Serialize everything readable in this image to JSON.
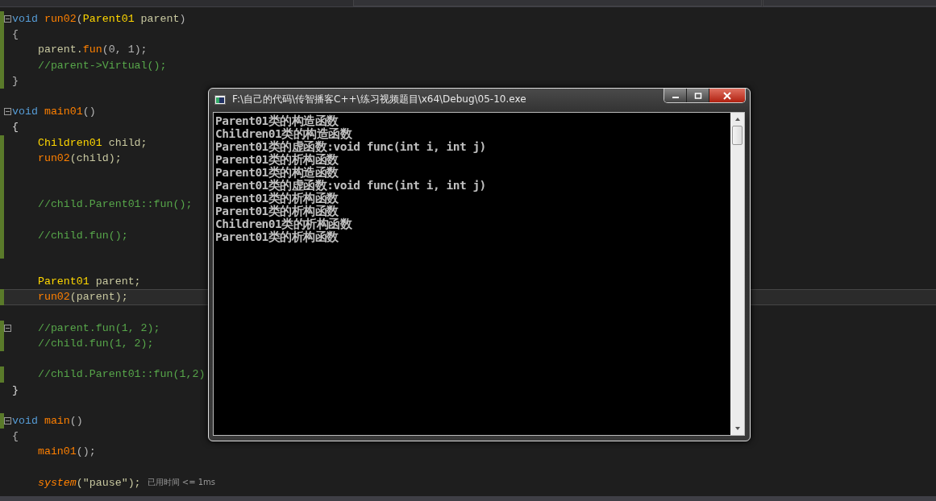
{
  "editor": {
    "lines": [
      {
        "tokens": [
          {
            "t": "void ",
            "color": "#569cd6"
          },
          {
            "t": "run02",
            "color": "#ff8000"
          },
          {
            "t": "(",
            "color": "#b4b4b4"
          },
          {
            "t": "Parent01",
            "color": "#ffd700"
          },
          {
            "t": " parent",
            "color": "#c8c8a0"
          },
          {
            "t": ")",
            "color": "#b4b4b4"
          }
        ],
        "fold": true,
        "changed": true,
        "current": false
      },
      {
        "tokens": [
          {
            "t": "{",
            "color": "#b4b4b4"
          }
        ],
        "fold": false,
        "changed": true,
        "current": false
      },
      {
        "tokens": [
          {
            "t": "    parent.",
            "color": "#c8c8a0"
          },
          {
            "t": "fun",
            "color": "#ff8000"
          },
          {
            "t": "(0, 1);",
            "color": "#b4b4b4"
          }
        ],
        "fold": false,
        "changed": true,
        "current": false
      },
      {
        "tokens": [
          {
            "t": "    //parent->Virtual();",
            "color": "#57a64a"
          }
        ],
        "fold": false,
        "changed": true,
        "current": false
      },
      {
        "tokens": [
          {
            "t": "}",
            "color": "#b4b4b4"
          }
        ],
        "fold": false,
        "changed": true,
        "current": false
      },
      {
        "fold": false,
        "changed": false,
        "current": false
      },
      {
        "tokens": [
          {
            "t": "void ",
            "color": "#569cd6"
          },
          {
            "t": "main01",
            "color": "#ff8000"
          },
          {
            "t": "()",
            "color": "#b4b4b4"
          }
        ],
        "fold": true,
        "changed": false,
        "current": false
      },
      {
        "tokens": [
          {
            "t": "{",
            "color": "#dcdcdc"
          }
        ],
        "fold": false,
        "changed": false,
        "current": false
      },
      {
        "tokens": [
          {
            "t": "    Children01",
            "color": "#ffd700"
          },
          {
            "t": " child;",
            "color": "#c8c8a0"
          }
        ],
        "fold": false,
        "changed": true,
        "current": false
      },
      {
        "tokens": [
          {
            "t": "    run02",
            "color": "#ff8000"
          },
          {
            "t": "(child);",
            "color": "#c8c8a0"
          }
        ],
        "fold": false,
        "changed": true,
        "current": false
      },
      {
        "fold": false,
        "changed": true,
        "current": false
      },
      {
        "fold": false,
        "changed": true,
        "current": false
      },
      {
        "tokens": [
          {
            "t": "    //child.Parent01::fun();",
            "color": "#57a64a"
          }
        ],
        "fold": false,
        "changed": true,
        "current": false
      },
      {
        "fold": false,
        "changed": true,
        "current": false
      },
      {
        "tokens": [
          {
            "t": "    //child.fun();",
            "color": "#57a64a"
          }
        ],
        "fold": false,
        "changed": true,
        "current": false
      },
      {
        "fold": false,
        "changed": true,
        "current": false
      },
      {
        "fold": false,
        "changed": false,
        "current": false
      },
      {
        "tokens": [
          {
            "t": "    Parent01",
            "color": "#ffd700"
          },
          {
            "t": " parent;",
            "color": "#c8c8a0"
          }
        ],
        "fold": false,
        "changed": false,
        "current": false
      },
      {
        "tokens": [
          {
            "t": "    run02",
            "color": "#ff8000"
          },
          {
            "t": "(parent);",
            "color": "#c8c8a0"
          }
        ],
        "fold": false,
        "changed": true,
        "current": true
      },
      {
        "fold": false,
        "changed": false,
        "current": false
      },
      {
        "tokens": [
          {
            "t": "    //parent.fun(1, 2);",
            "color": "#57a64a"
          }
        ],
        "fold": true,
        "changed": true,
        "current": false
      },
      {
        "tokens": [
          {
            "t": "    //child.fun(1, 2);",
            "color": "#57a64a"
          }
        ],
        "fold": false,
        "changed": true,
        "current": false
      },
      {
        "fold": false,
        "changed": false,
        "current": false
      },
      {
        "tokens": [
          {
            "t": "    //child.Parent01::fun(1,2)",
            "color": "#57a64a"
          }
        ],
        "fold": false,
        "changed": true,
        "current": false
      },
      {
        "tokens": [
          {
            "t": "}",
            "color": "#dcdcdc"
          }
        ],
        "fold": false,
        "changed": false,
        "current": false
      },
      {
        "fold": false,
        "changed": false,
        "current": false
      },
      {
        "tokens": [
          {
            "t": "void ",
            "color": "#569cd6"
          },
          {
            "t": "main",
            "color": "#ff8000"
          },
          {
            "t": "()",
            "color": "#b4b4b4"
          }
        ],
        "fold": true,
        "changed": true,
        "current": false
      },
      {
        "tokens": [
          {
            "t": "{",
            "color": "#b4b4b4"
          }
        ],
        "fold": false,
        "changed": false,
        "current": false
      },
      {
        "tokens": [
          {
            "t": "    main01",
            "color": "#ff8000"
          },
          {
            "t": "();",
            "color": "#b4b4b4"
          }
        ],
        "fold": false,
        "changed": false,
        "current": false
      },
      {
        "fold": false,
        "changed": false,
        "current": false
      },
      {
        "tokens": [
          {
            "t": "    system",
            "color": "#ff8000",
            "italic": true
          },
          {
            "t": "(\"pause\");",
            "color": "#c8c8a0"
          }
        ],
        "hint": "已用时间 <= 1ms",
        "fold": false,
        "changed": false,
        "current": false
      }
    ]
  },
  "console": {
    "title": "F:\\自己的代码\\传智播客C++\\练习视频题目\\x64\\Debug\\05-10.exe",
    "output": [
      "Parent01类的构造函数",
      "Children01类的构造函数",
      "Parent01类的虚函数:void func(int i, int j)",
      "Parent01类的析构函数",
      "Parent01类的构造函数",
      "Parent01类的虚函数:void func(int i, int j)",
      "Parent01类的析构函数",
      "Parent01类的析构函数",
      "Children01类的析构函数",
      "Parent01类的析构函数"
    ]
  }
}
